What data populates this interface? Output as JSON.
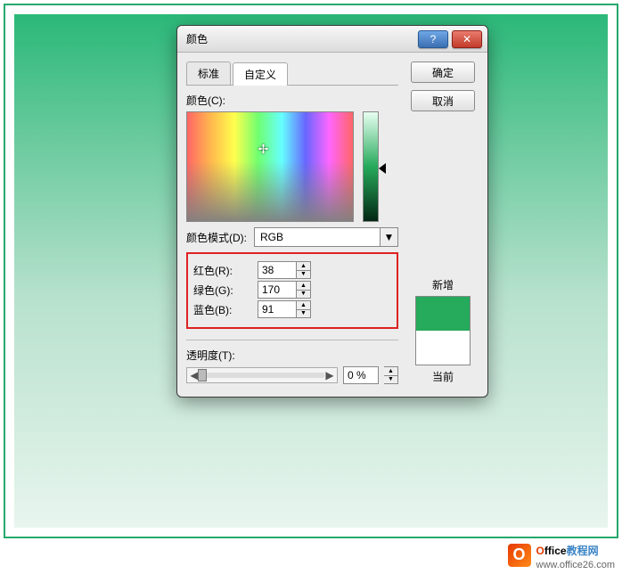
{
  "dialog": {
    "title": "颜色",
    "tabs": {
      "standard": "标准",
      "custom": "自定义"
    },
    "buttons": {
      "ok": "确定",
      "cancel": "取消"
    },
    "color_label": "颜色(C):",
    "model_label": "颜色模式(D):",
    "model_value": "RGB",
    "rgb": {
      "r_label": "红色(R):",
      "r_value": "38",
      "g_label": "绿色(G):",
      "g_value": "170",
      "b_label": "蓝色(B):",
      "b_value": "91"
    },
    "transparency_label": "透明度(T):",
    "transparency_value": "0 %",
    "new_label": "新增",
    "current_label": "当前",
    "help": "?",
    "close": "✕",
    "crosshair": "✢",
    "dd_arrow": "▼",
    "up": "▲",
    "down": "▼",
    "larr": "◀",
    "rarr": "▶"
  },
  "branding": {
    "badge": "O",
    "name_head": "O",
    "name_mid": "ffice",
    "name_tail": "教程网",
    "url": "www.office26.com"
  },
  "chart_data": {
    "type": "color-picker",
    "model": "RGB",
    "values": {
      "r": 38,
      "g": 170,
      "b": 91
    },
    "transparency_percent": 0,
    "swatch_hex": "#26AA5B"
  }
}
